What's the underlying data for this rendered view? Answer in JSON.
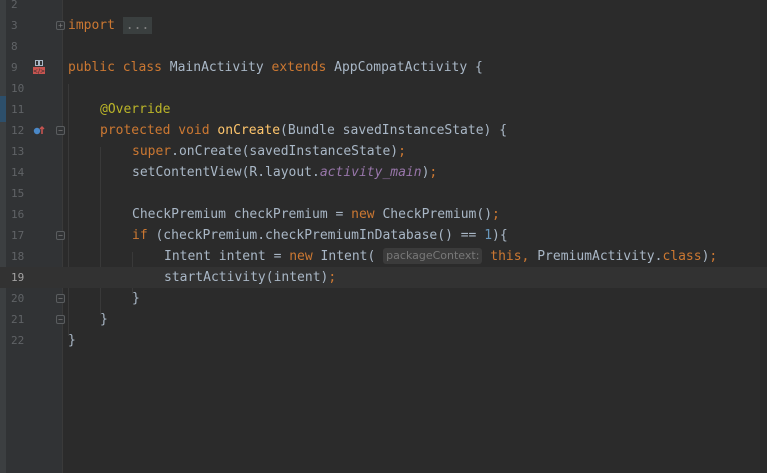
{
  "gutter": {
    "line_numbers": [
      "2",
      "3",
      "8",
      "9",
      "10",
      "11",
      "12",
      "13",
      "14",
      "15",
      "16",
      "17",
      "18",
      "19",
      "20",
      "21",
      "22"
    ],
    "current_line": "19"
  },
  "code": {
    "import_kw": "import",
    "import_folded": "...",
    "class_decl": {
      "public": "public",
      "class": "class",
      "name": "MainActivity",
      "extends": "extends",
      "super": "AppCompatActivity",
      "brace": "{"
    },
    "annotation": "@Override",
    "method_decl": {
      "protected": "protected",
      "void": "void",
      "name": "onCreate",
      "params": "(Bundle savedInstanceState) {"
    },
    "super_call": {
      "super": "super",
      "rest": ".onCreate(savedInstanceState)",
      "semi": ";"
    },
    "set_content": {
      "call": "setContentView(R.layout.",
      "field": "activity_main",
      "close": ")",
      "semi": ";"
    },
    "check_decl": {
      "lhs": "CheckPremium checkPremium = ",
      "new": "new",
      "rhs": " CheckPremium()",
      "semi": ";"
    },
    "if_stmt": {
      "if": "if",
      "cond": " (checkPremium.checkPremiumInDatabase() == ",
      "num": "1",
      "close": "){"
    },
    "intent_decl": {
      "lhs": "Intent intent = ",
      "new": "new",
      "ctor": " Intent(",
      "hint": "packageContext:",
      "this": "this,",
      "arg2": " PremiumActivity.",
      "classkw": "class",
      "close": ")",
      "semi": ";"
    },
    "start_activity": {
      "call": "startActivity(intent)",
      "semi": ";"
    },
    "close_if": "}",
    "close_method": "}",
    "close_class": "}"
  },
  "icons": [
    "fold-expanded-icon",
    "implementation-icon",
    "override-method-icon"
  ],
  "colors": {
    "background": "#2b2b2b",
    "gutter": "#313335",
    "keyword": "#cc7832",
    "method": "#ffc66d",
    "annotation": "#bbb529",
    "number": "#6897bb",
    "field": "#9876aa",
    "text": "#a9b7c6"
  }
}
